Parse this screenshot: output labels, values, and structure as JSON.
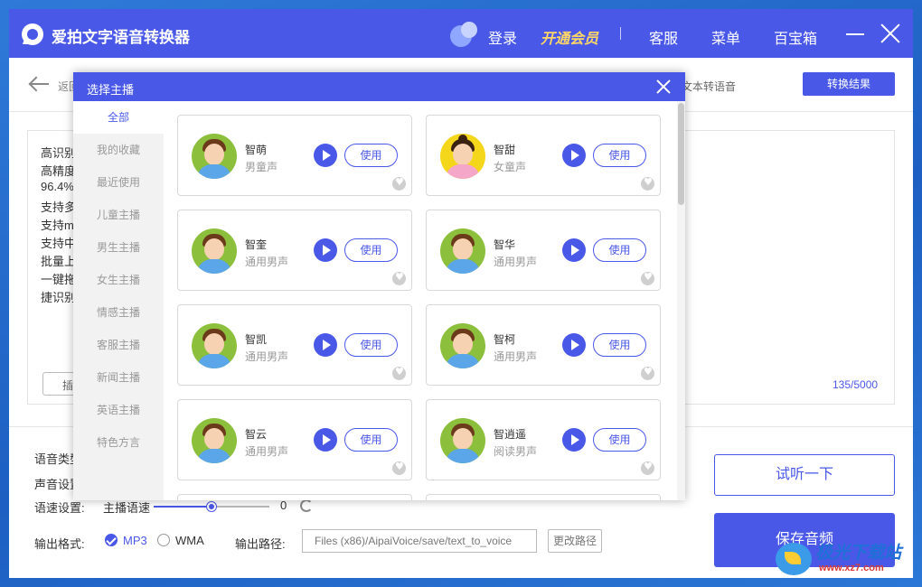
{
  "app": {
    "title": "爱拍文字语音转换器",
    "login": "登录",
    "vip": "开通会员",
    "service": "客服",
    "menu": "菜单",
    "toolbox": "百宝箱"
  },
  "subheader": {
    "back_label": "返回",
    "crumb": "文本转语音",
    "result_button": "转换结果"
  },
  "text_panel": {
    "lines": [
      "高识别",
      "高精度",
      "96.4%",
      "支持多",
      "支持m",
      "支持中",
      "批量上",
      "一键拖",
      "捷识别"
    ],
    "insert_button": "插",
    "counter": "135/5000"
  },
  "settings": {
    "voice_type_label": "语音类型",
    "sound_label": "声音设置",
    "speed_label": "语速设置:",
    "speed_sub_label": "主播语速",
    "speed_value": "0",
    "speed_fraction": 0.5,
    "format_label": "输出格式:",
    "formats": [
      {
        "label": "MP3",
        "selected": true
      },
      {
        "label": "WMA",
        "selected": false
      }
    ],
    "path_label": "输出路径:",
    "path_value": "Files (x86)/AipaiVoice/save/text_to_voice",
    "path_button": "更改路径",
    "preview_button": "试听一下",
    "save_button": "保存音频"
  },
  "modal": {
    "title": "选择主播",
    "categories": [
      "全部",
      "我的收藏",
      "最近使用",
      "儿童主播",
      "男生主播",
      "女生主播",
      "情感主播",
      "客服主播",
      "新闻主播",
      "英语主播",
      "特色方言"
    ],
    "active_category": 0,
    "use_label": "使用",
    "voices": [
      {
        "name": "智萌",
        "type": "男童声",
        "gender": "male"
      },
      {
        "name": "智甜",
        "type": "女童声",
        "gender": "female"
      },
      {
        "name": "智奎",
        "type": "通用男声",
        "gender": "male"
      },
      {
        "name": "智华",
        "type": "通用男声",
        "gender": "male"
      },
      {
        "name": "智凯",
        "type": "通用男声",
        "gender": "male"
      },
      {
        "name": "智柯",
        "type": "通用男声",
        "gender": "male"
      },
      {
        "name": "智云",
        "type": "通用男声",
        "gender": "male"
      },
      {
        "name": "智逍遥",
        "type": "阅读男声",
        "gender": "male"
      }
    ]
  },
  "watermark": {
    "brand": "极光下载站",
    "url": "www.xz7.com"
  },
  "colors": {
    "accent": "#4a58e8",
    "vip": "#ffd766"
  }
}
